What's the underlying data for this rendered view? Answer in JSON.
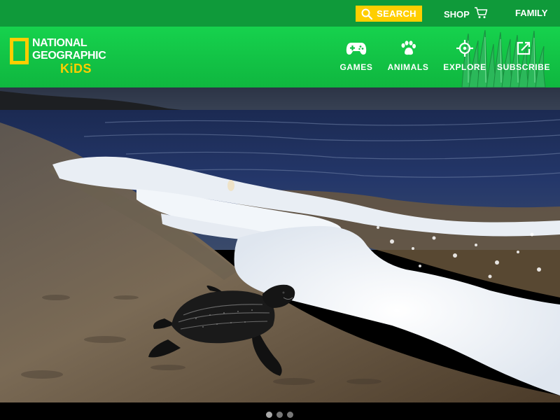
{
  "topbar": {
    "search_label": "SEARCH",
    "shop_label": "SHOP",
    "family_label": "FAMILY"
  },
  "logo": {
    "line1": "NATIONAL",
    "line2": "GEOGRAPHIC",
    "line3": "KiDS"
  },
  "nav": {
    "items": [
      {
        "label": "GAMES",
        "icon": "gamepad-icon"
      },
      {
        "label": "ANIMALS",
        "icon": "paw-icon"
      },
      {
        "label": "EXPLORE",
        "icon": "crosshair-icon"
      },
      {
        "label": "SUBSCRIBE",
        "icon": "external-link-icon"
      }
    ]
  },
  "hero": {
    "image": "baby-turtle-on-beach"
  },
  "carousel": {
    "dot_count": 3,
    "active_index": 0
  },
  "colors": {
    "topbar_bg": "#0f9a3a",
    "navbar_bg": "#16d24d",
    "accent_yellow": "#ffce00",
    "text_white": "#ffffff"
  }
}
